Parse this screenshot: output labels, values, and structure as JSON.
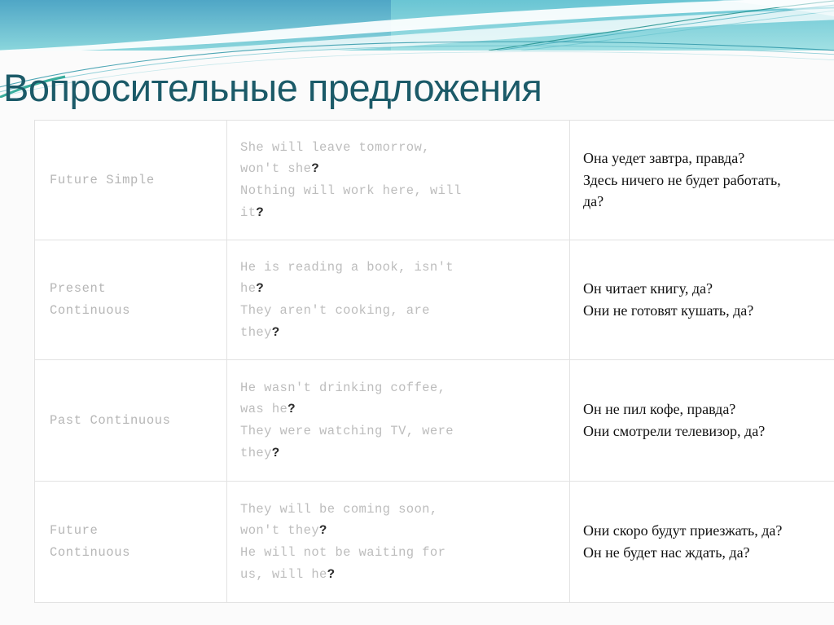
{
  "slide": {
    "title": "Вопросительные предложения",
    "background_color": "#fbfbfb",
    "title_color": "#1b5a68",
    "banner_colors": {
      "blue_left": "#4fa8c9",
      "cyan_right": "#7fd4d8",
      "teal_line": "#1f8f8a",
      "white": "#ffffff"
    }
  },
  "table": {
    "border_color": "#e2e2e2",
    "english_text_color": "#bdbdbd",
    "question_mark_color": "#2b2b2b",
    "russian_text_color": "#111111",
    "rows": [
      {
        "tense": "Future Simple",
        "english_lines": [
          {
            "text": "She will leave tomorrow, won't she",
            "mark": "?"
          },
          {
            "text": "Nothing will work here, will it",
            "mark": "?"
          }
        ],
        "english_plain": "She will leave tomorrow,\nwon't she?\nNothing will work here, will\nit?",
        "russian": "Она уедет завтра, правда?\nЗдесь ничего не будет работать,\nда?"
      },
      {
        "tense": "Present\nContinuous",
        "english_lines": [
          {
            "text": "He is reading a book, isn't he",
            "mark": "?"
          },
          {
            "text": "They aren't cooking, are they",
            "mark": "?"
          }
        ],
        "english_plain": "He is reading a book, isn't\nhe?\nThey aren't cooking, are\nthey?",
        "russian": "Он читает книгу, да?\nОни не готовят кушать, да?"
      },
      {
        "tense": "Past Continuous",
        "english_lines": [
          {
            "text": "He wasn't drinking coffee, was he",
            "mark": "?"
          },
          {
            "text": "They were watching TV, were they",
            "mark": "?"
          }
        ],
        "english_plain": "He wasn't drinking coffee,\nwas he?\nThey were watching TV, were\nthey?",
        "russian": "Он не пил кофе, правда?\nОни смотрели телевизор, да?"
      },
      {
        "tense": "Future\nContinuous",
        "english_lines": [
          {
            "text": "They will be coming soon, won't they",
            "mark": "?"
          },
          {
            "text": "He will not be waiting for us, will he",
            "mark": "?"
          }
        ],
        "english_plain": "They will be coming soon,\nwon't they?\nHe will not be waiting for\nus, will he?",
        "russian": "Они скоро будут приезжать, да?\nОн не будет нас ждать, да?"
      }
    ]
  }
}
